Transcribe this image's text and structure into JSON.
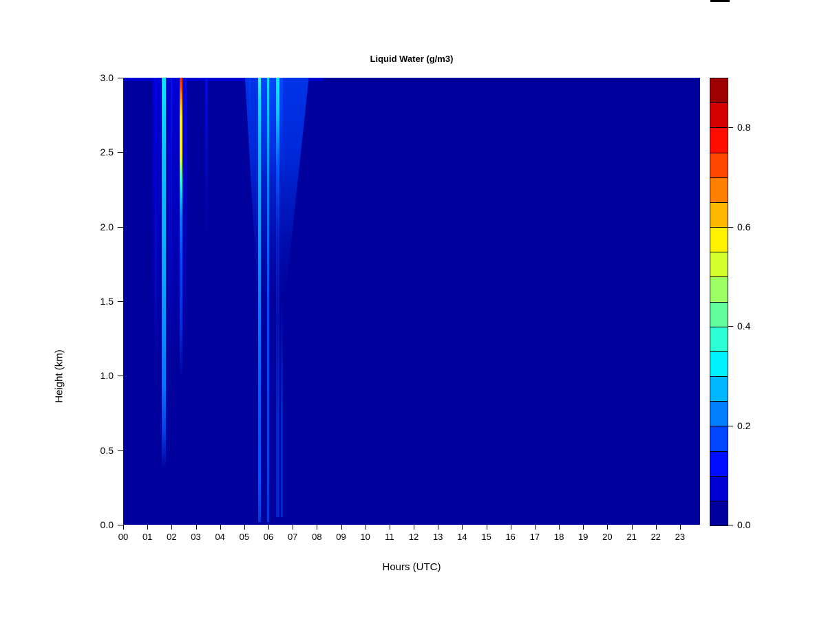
{
  "chart_data": {
    "type": "heatmap",
    "title": "Liquid Water (g/m3)",
    "xlabel": "Hours (UTC)",
    "ylabel": "Height (km)",
    "value_unit": "g/m3",
    "x_range_hours": [
      0,
      23.8
    ],
    "y_range_km": [
      0.0,
      3.0
    ],
    "background_value": 0.0,
    "grid": false,
    "x_ticks": [
      "00",
      "01",
      "02",
      "03",
      "04",
      "05",
      "06",
      "07",
      "08",
      "09",
      "10",
      "11",
      "12",
      "13",
      "14",
      "15",
      "16",
      "17",
      "18",
      "19",
      "20",
      "21",
      "22",
      "23"
    ],
    "y_ticks": [
      {
        "v": 0.0,
        "label": "0.0"
      },
      {
        "v": 0.5,
        "label": "0.5"
      },
      {
        "v": 1.0,
        "label": "1.0"
      },
      {
        "v": 1.5,
        "label": "1.5"
      },
      {
        "v": 2.0,
        "label": "2.0"
      },
      {
        "v": 2.5,
        "label": "2.5"
      },
      {
        "v": 3.0,
        "label": "3.0"
      }
    ],
    "colorbar": {
      "position": "right",
      "value_min": 0.0,
      "value_max": 0.9,
      "n_segments": 18,
      "segment_step": 0.05,
      "colors_top_to_bottom": [
        "#9C0000",
        "#D50000",
        "#FF0E00",
        "#FF4700",
        "#FF8000",
        "#FFB800",
        "#FFF100",
        "#D5FF2A",
        "#9CFF63",
        "#63FF9C",
        "#2AFFD5",
        "#00F1FF",
        "#00B8FF",
        "#0080FF",
        "#0047FF",
        "#000EFF",
        "#0000D5",
        "#00009C"
      ],
      "ticks": [
        {
          "v": 0.8,
          "label": "0.8"
        },
        {
          "v": 0.6,
          "label": "0.6"
        },
        {
          "v": 0.4,
          "label": "0.4"
        },
        {
          "v": 0.2,
          "label": "0.2"
        },
        {
          "v": 0.0,
          "label": "0.0"
        }
      ],
      "background_color": "#00009C"
    },
    "features": [
      {
        "name": "top-edge-band",
        "hour": 0.0,
        "width_hours": 8.25,
        "km_top": 3.0,
        "km_bottom": 2.975,
        "peak_value": 0.07,
        "gradient": [
          [
            0,
            "#0000D2"
          ],
          [
            1,
            "#0000D2"
          ]
        ]
      },
      {
        "name": "halo-0120-0240",
        "hour": 1.22,
        "width_hours": 1.42,
        "km_top": 3.0,
        "km_bottom": 1.1,
        "peak_value": 0.07,
        "gradient": [
          [
            0,
            "rgba(0,0,218,0.9)"
          ],
          [
            0.55,
            "rgba(0,0,205,0.55)"
          ],
          [
            1,
            "rgba(0,0,156,0)"
          ]
        ]
      },
      {
        "name": "faint-streak-0118",
        "hour": 1.3,
        "width_hours": 0.06,
        "km_top": 3.0,
        "km_bottom": 1.05,
        "peak_value": 0.1,
        "gradient": [
          [
            0,
            "#0000EE"
          ],
          [
            0.75,
            "rgba(0,10,225,0.5)"
          ],
          [
            1,
            "rgba(0,0,156,0)"
          ]
        ]
      },
      {
        "name": "cyan-streak-0140",
        "hour": 1.6,
        "width_hours": 0.15,
        "km_top": 3.0,
        "km_bottom": 0.37,
        "peak_value": 0.33,
        "gradient": [
          [
            0,
            "#00E9FF"
          ],
          [
            0.2,
            "#00C8FF"
          ],
          [
            0.5,
            "#00AAFF"
          ],
          [
            0.78,
            "#0078FF"
          ],
          [
            0.9,
            "#0040E8"
          ],
          [
            1,
            "rgba(0,20,180,0)"
          ]
        ]
      },
      {
        "name": "faint-streak-0200",
        "hour": 1.97,
        "width_hours": 0.06,
        "km_top": 3.0,
        "km_bottom": 1.2,
        "peak_value": 0.1,
        "gradient": [
          [
            0,
            "#0018E8"
          ],
          [
            1,
            "rgba(0,0,156,0)"
          ]
        ]
      },
      {
        "name": "rainbow-streak-0220",
        "hour": 2.32,
        "width_hours": 0.12,
        "km_top": 3.0,
        "km_bottom": 0.98,
        "peak_value": 0.78,
        "gradient": [
          [
            0,
            "#FF2000"
          ],
          [
            0.03,
            "#FF4700"
          ],
          [
            0.055,
            "#FF8000"
          ],
          [
            0.09,
            "#FFB800"
          ],
          [
            0.13,
            "#FFF100"
          ],
          [
            0.25,
            "#FFF100"
          ],
          [
            0.28,
            "#C8FF30"
          ],
          [
            0.31,
            "#63FF9C"
          ],
          [
            0.34,
            "#2AFFD5"
          ],
          [
            0.39,
            "#00D0FF"
          ],
          [
            0.46,
            "#0080FF"
          ],
          [
            0.6,
            "#0048FF"
          ],
          [
            0.82,
            "#0030E0"
          ],
          [
            1,
            "rgba(0,20,160,0)"
          ]
        ]
      },
      {
        "name": "faint-streak-0235",
        "hour": 2.56,
        "width_hours": 0.06,
        "km_top": 3.0,
        "km_bottom": 2.1,
        "peak_value": 0.08,
        "gradient": [
          [
            0,
            "#0008F0"
          ],
          [
            1,
            "rgba(0,0,156,0)"
          ]
        ]
      },
      {
        "name": "faint-band-0325",
        "hour": 3.38,
        "width_hours": 0.12,
        "km_top": 3.0,
        "km_bottom": 1.85,
        "peak_value": 0.08,
        "gradient": [
          [
            0,
            "#000CE4"
          ],
          [
            0.6,
            "rgba(0,10,210,0.5)"
          ],
          [
            1,
            "rgba(0,0,156,0)"
          ]
        ]
      },
      {
        "name": "fan-0500-0740",
        "hour": 5.03,
        "width_hours": 2.64,
        "km_top": 3.0,
        "km_bottom": 1.52,
        "peak_value": 0.15,
        "taper": [
          0.2,
          0.63
        ],
        "gradient": [
          [
            0,
            "#0034E8"
          ],
          [
            0.35,
            "#0028D8"
          ],
          [
            0.75,
            "rgba(0,24,190,0.5)"
          ],
          [
            1,
            "rgba(0,0,156,0)"
          ]
        ]
      },
      {
        "name": "fan-core",
        "hour": 5.55,
        "width_hours": 1.05,
        "km_top": 3.0,
        "km_bottom": 2.35,
        "peak_value": 0.18,
        "gradient": [
          [
            0,
            "#0048FF"
          ],
          [
            0.6,
            "rgba(0,56,240,0.6)"
          ],
          [
            1,
            "rgba(0,0,156,0)"
          ]
        ]
      },
      {
        "name": "faint-streak-0512",
        "hour": 5.2,
        "width_hours": 0.06,
        "km_top": 3.0,
        "km_bottom": 2.75,
        "peak_value": 0.12,
        "gradient": [
          [
            0,
            "#0040FF"
          ],
          [
            1,
            "rgba(0,0,156,0)"
          ]
        ]
      },
      {
        "name": "bright-streak-0535",
        "hour": 5.56,
        "width_hours": 0.12,
        "km_top": 3.0,
        "km_bottom": 0.02,
        "peak_value": 0.38,
        "gradient": [
          [
            0,
            "#40FFD8"
          ],
          [
            0.05,
            "#00E5FF"
          ],
          [
            0.15,
            "#00C0FF"
          ],
          [
            0.35,
            "#00A0FF"
          ],
          [
            0.55,
            "#0078FF"
          ],
          [
            0.75,
            "#0058FF"
          ],
          [
            0.92,
            "#0050FF"
          ],
          [
            1,
            "#0038D8"
          ]
        ]
      },
      {
        "name": "streak-0557",
        "hour": 5.93,
        "width_hours": 0.09,
        "km_top": 3.0,
        "km_bottom": 0.02,
        "peak_value": 0.32,
        "gradient": [
          [
            0,
            "#00E5FF"
          ],
          [
            0.1,
            "#00BFFF"
          ],
          [
            0.25,
            "#0080FF"
          ],
          [
            0.5,
            "#0048FF"
          ],
          [
            0.8,
            "#0040EE"
          ],
          [
            1,
            "#0038E0"
          ]
        ]
      },
      {
        "name": "streak-0620",
        "hour": 6.32,
        "width_hours": 0.14,
        "km_top": 3.0,
        "km_bottom": 0.05,
        "peak_value": 0.33,
        "gradient": [
          [
            0,
            "#00F1FF"
          ],
          [
            0.08,
            "#00CFFF"
          ],
          [
            0.2,
            "#0058FF"
          ],
          [
            0.35,
            "rgba(0,40,210,0.8)"
          ],
          [
            0.55,
            "rgba(0,30,195,0.55)"
          ],
          [
            0.8,
            "#0028D0"
          ],
          [
            1,
            "#0028D0"
          ]
        ]
      },
      {
        "name": "faint-streak-0632-low",
        "hour": 6.52,
        "width_hours": 0.09,
        "km_top": 1.55,
        "km_bottom": 0.05,
        "peak_value": 0.1,
        "gradient": [
          [
            0,
            "rgba(0,30,200,0)"
          ],
          [
            0.5,
            "#0024C8"
          ],
          [
            1,
            "#0024C8"
          ]
        ]
      }
    ]
  }
}
